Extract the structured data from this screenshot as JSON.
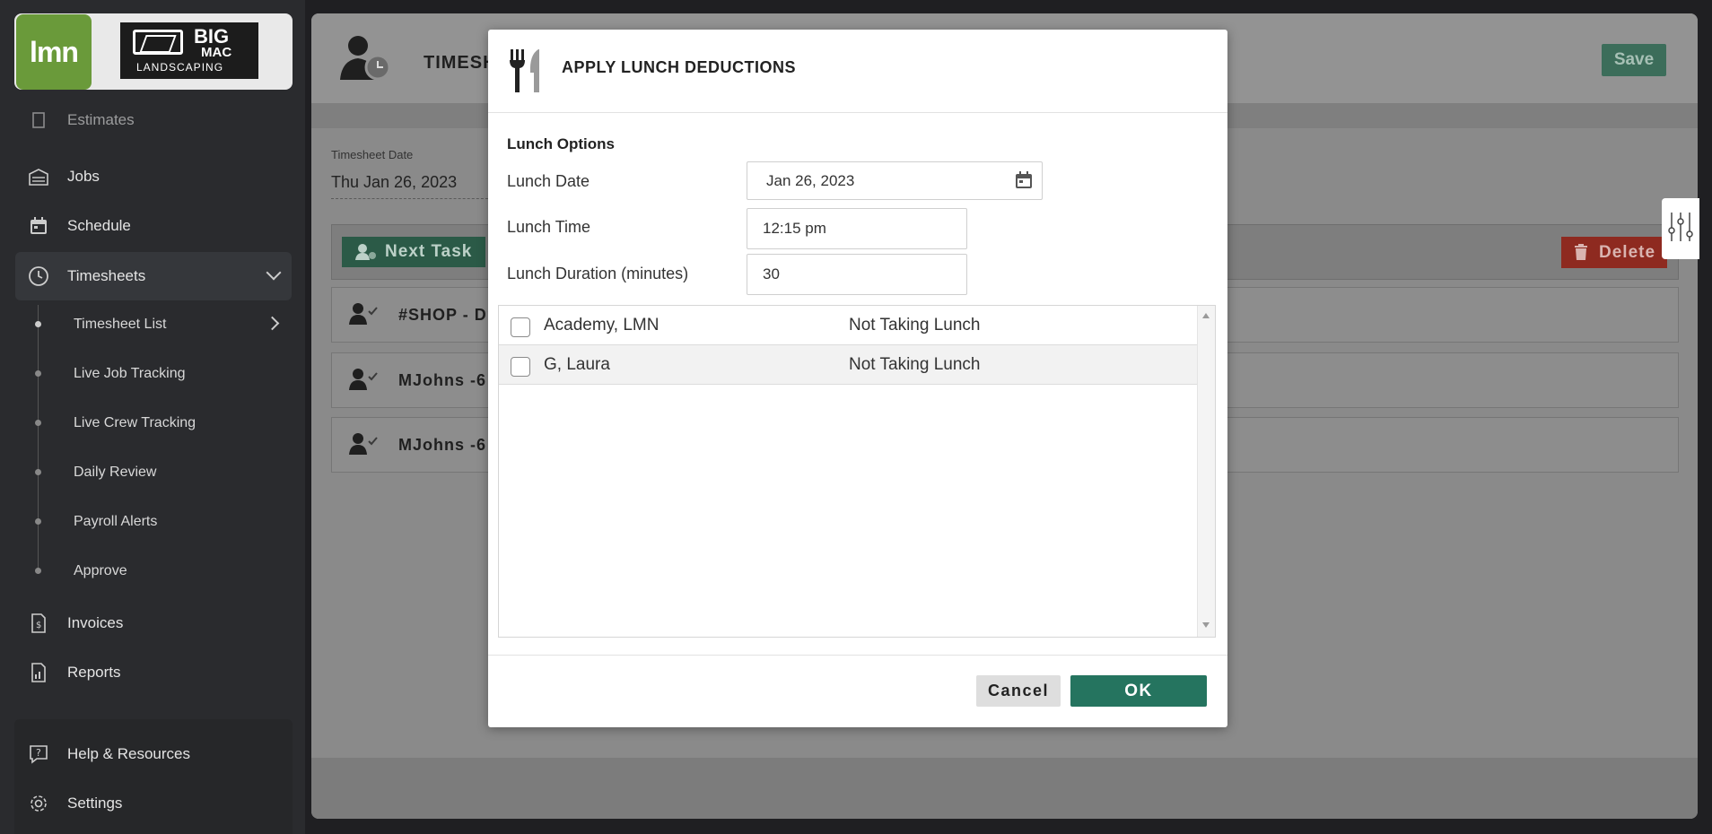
{
  "brand": {
    "app_logo": "lmn",
    "company_big": "BIG",
    "company_mac": "MAC",
    "company_sub": "LANDSCAPING"
  },
  "sidebar": {
    "items": [
      {
        "label": "Estimates",
        "icon": "estimate-icon"
      },
      {
        "label": "Jobs",
        "icon": "jobs-icon"
      },
      {
        "label": "Schedule",
        "icon": "calendar-icon"
      },
      {
        "label": "Timesheets",
        "icon": "clock-icon"
      },
      {
        "label": "Invoices",
        "icon": "invoice-icon"
      },
      {
        "label": "Reports",
        "icon": "report-icon"
      }
    ],
    "subitems": [
      {
        "label": "Timesheet List"
      },
      {
        "label": "Live Job Tracking"
      },
      {
        "label": "Live Crew Tracking"
      },
      {
        "label": "Daily Review"
      },
      {
        "label": "Payroll Alerts"
      },
      {
        "label": "Approve"
      }
    ],
    "bottom": [
      {
        "label": "Help & Resources",
        "icon": "help-icon"
      },
      {
        "label": "Settings",
        "icon": "gear-icon"
      }
    ]
  },
  "main": {
    "title": "TIMESH",
    "save_label": "Save",
    "timesheet_date_label": "Timesheet Date",
    "timesheet_date_value": "Thu Jan 26, 2023",
    "next_task_label": "Next Task",
    "delete_label": "Delete",
    "rows": [
      {
        "text": "#SHOP - Dr"
      },
      {
        "text": "MJohns -6"
      },
      {
        "text": "MJohns -6"
      }
    ]
  },
  "modal": {
    "title": "APPLY LUNCH DEDUCTIONS",
    "section_title": "Lunch Options",
    "lunch_date_label": "Lunch Date",
    "lunch_date_value": "Jan 26, 2023",
    "lunch_time_label": "Lunch Time",
    "lunch_time_value": "12:15 pm",
    "lunch_duration_label": "Lunch Duration (minutes)",
    "lunch_duration_value": "30",
    "employees": [
      {
        "name": "Academy, LMN",
        "status": "Not Taking Lunch",
        "checked": false
      },
      {
        "name": "G, Laura",
        "status": "Not Taking Lunch",
        "checked": false
      }
    ],
    "cancel_label": "Cancel",
    "ok_label": "OK"
  },
  "colors": {
    "ok_button": "#25745f",
    "sidebar_bg": "#2a2b2e",
    "lmn_green": "#6a9a3a"
  }
}
